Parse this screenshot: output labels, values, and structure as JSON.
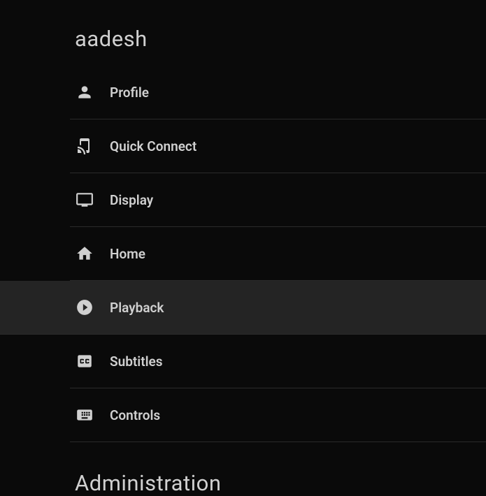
{
  "section_user_title": "aadesh",
  "section_admin_title": "Administration",
  "menu": {
    "items": [
      {
        "label": "Profile",
        "icon": "person",
        "selected": false
      },
      {
        "label": "Quick Connect",
        "icon": "tap-play",
        "selected": false
      },
      {
        "label": "Display",
        "icon": "tv",
        "selected": false
      },
      {
        "label": "Home",
        "icon": "home",
        "selected": false
      },
      {
        "label": "Playback",
        "icon": "play-circle",
        "selected": true
      },
      {
        "label": "Subtitles",
        "icon": "cc",
        "selected": false
      },
      {
        "label": "Controls",
        "icon": "keyboard",
        "selected": false
      }
    ]
  }
}
